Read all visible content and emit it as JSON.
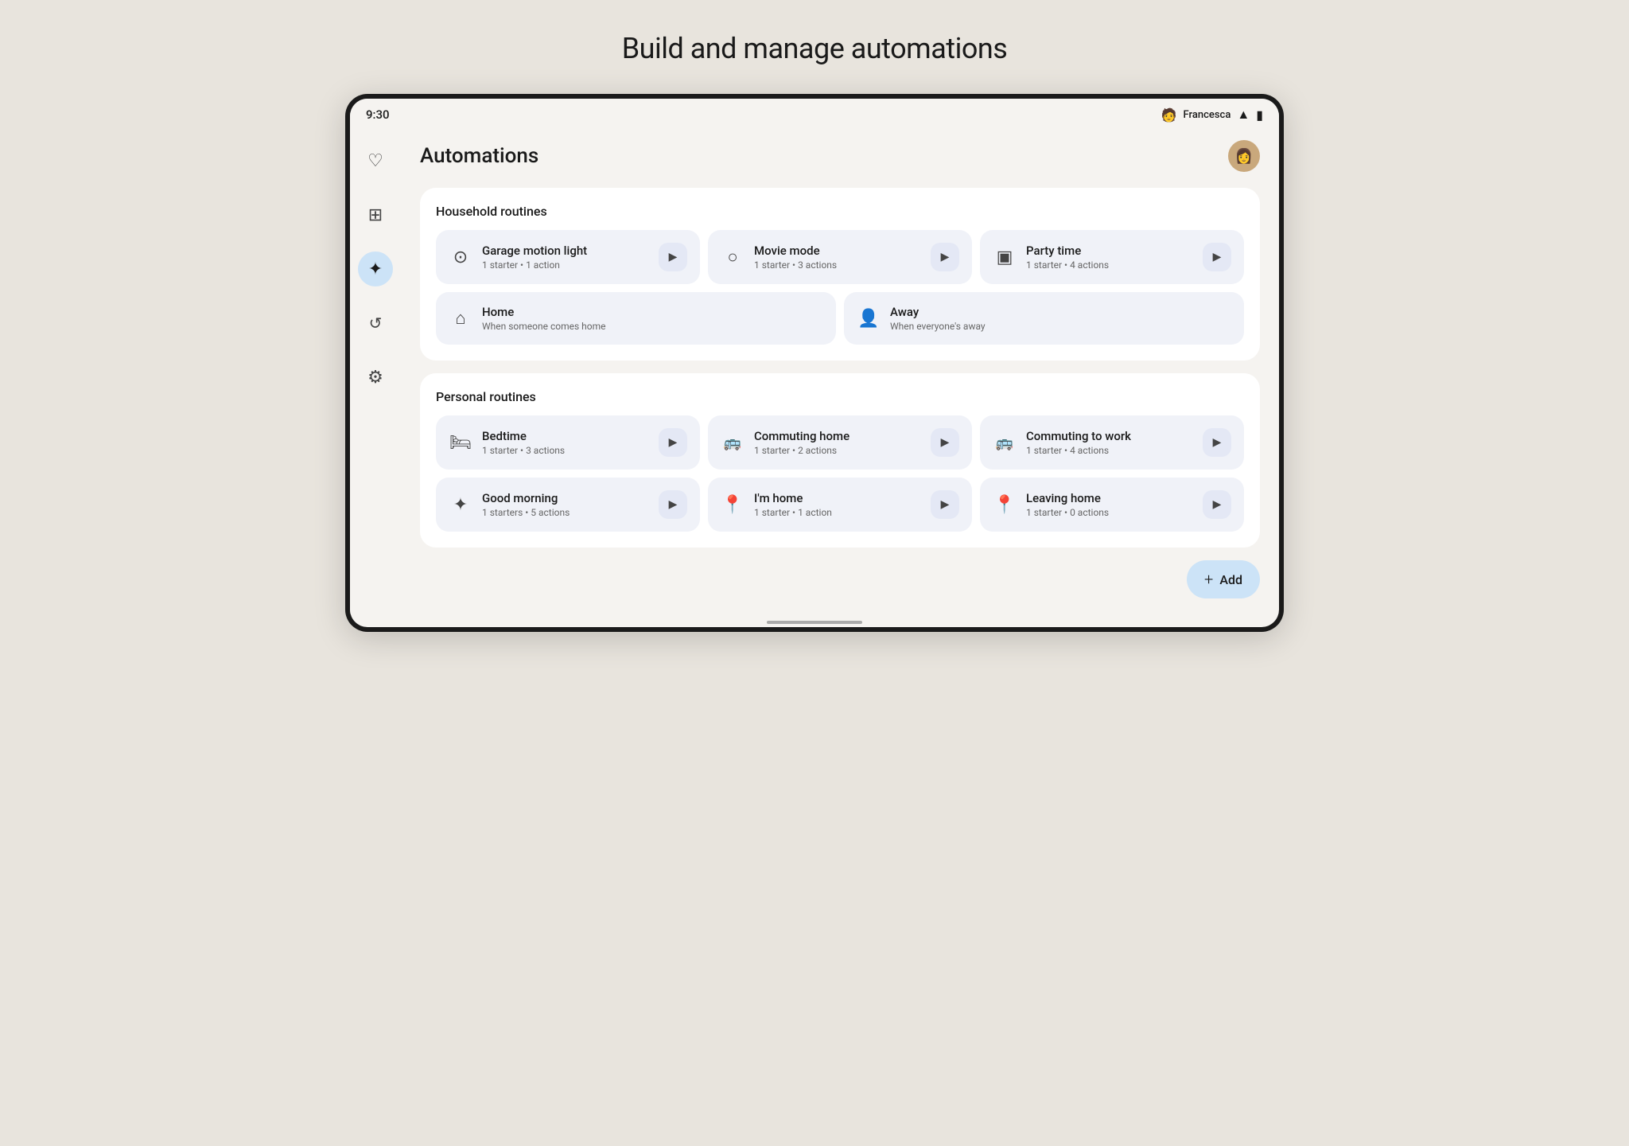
{
  "page": {
    "title": "Build and manage automations"
  },
  "status": {
    "time": "9:30",
    "user": "Francesca",
    "wifi_icon": "▲",
    "battery_icon": "▮"
  },
  "screen": {
    "title": "Automations",
    "avatar_emoji": "👩"
  },
  "sections": [
    {
      "id": "household",
      "title": "Household routines",
      "rows": [
        [
          {
            "name": "Garage motion light",
            "meta": "1 starter • 1 action",
            "icon": "⚙",
            "has_play": true
          },
          {
            "name": "Movie mode",
            "meta": "1 starter • 3 actions",
            "icon": "💡",
            "has_play": true
          },
          {
            "name": "Party time",
            "meta": "1 starter • 4 actions",
            "icon": "🎵",
            "has_play": true
          }
        ]
      ],
      "bottom_row": [
        {
          "name": "Home",
          "meta": "When someone comes home",
          "icon": "🏠",
          "has_play": false
        },
        {
          "name": "Away",
          "meta": "When everyone's away",
          "icon": "👥",
          "has_play": false
        }
      ]
    },
    {
      "id": "personal",
      "title": "Personal routines",
      "rows": [
        [
          {
            "name": "Bedtime",
            "meta": "1 starter • 3 actions",
            "icon": "🛏",
            "has_play": true
          },
          {
            "name": "Commuting home",
            "meta": "1 starter • 2 actions",
            "icon": "🚌",
            "has_play": true
          },
          {
            "name": "Commuting to work",
            "meta": "1 starter • 4 actions",
            "icon": "🚌",
            "has_play": true
          }
        ],
        [
          {
            "name": "Good morning",
            "meta": "1 starters • 5 actions",
            "icon": "✦",
            "has_play": true
          },
          {
            "name": "I'm home",
            "meta": "1 starter • 1 action",
            "icon": "📍",
            "has_play": true
          },
          {
            "name": "Leaving home",
            "meta": "1 starter • 0 actions",
            "icon": "📍",
            "has_play": true
          }
        ]
      ]
    }
  ],
  "fab": {
    "label": "Add",
    "icon": "+"
  },
  "sidebar": {
    "items": [
      {
        "icon": "♡",
        "label": "favorites",
        "active": false
      },
      {
        "icon": "▣",
        "label": "dashboard",
        "active": false
      },
      {
        "icon": "✦",
        "label": "automations",
        "active": true
      },
      {
        "icon": "⟳",
        "label": "history",
        "active": false
      },
      {
        "icon": "⚙",
        "label": "settings",
        "active": false
      }
    ]
  }
}
